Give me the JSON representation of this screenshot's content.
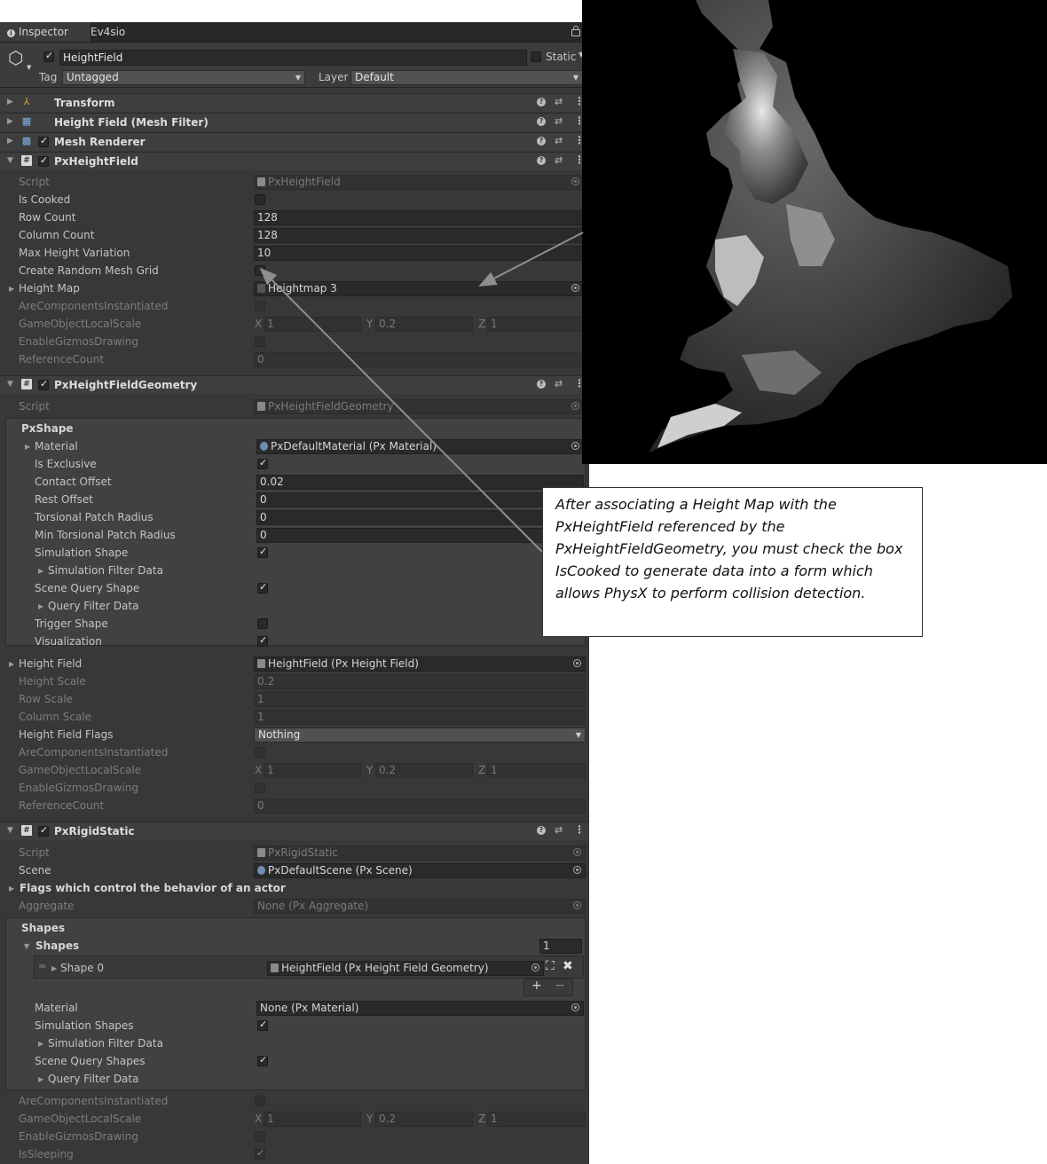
{
  "tabs": [
    {
      "label": "Inspector"
    },
    {
      "label": "Ev4sio"
    }
  ],
  "gameobject": {
    "name": "HeightField",
    "static_label": "Static",
    "tag_label": "Tag",
    "tag_value": "Untagged",
    "layer_label": "Layer",
    "layer_value": "Default"
  },
  "components": {
    "transform": {
      "title": "Transform"
    },
    "mesh_filter": {
      "title": "Height Field (Mesh Filter)"
    },
    "mesh_renderer": {
      "title": "Mesh Renderer"
    },
    "px_height_field": {
      "title": "PxHeightField",
      "labels": {
        "script": "Script",
        "is_cooked": "Is Cooked",
        "row_count": "Row Count",
        "column_count": "Column Count",
        "max_height_variation": "Max Height Variation",
        "create_random": "Create Random Mesh Grid",
        "height_map": "Height Map",
        "are_comp": "AreComponentsInstantiated",
        "local_scale": "GameObjectLocalScale",
        "gizmos": "EnableGizmosDrawing",
        "ref_count": "ReferenceCount"
      },
      "values": {
        "script": "PxHeightField",
        "row_count": "128",
        "column_count": "128",
        "max_height_variation": "10",
        "height_map": "Heightmap 3",
        "scale_x": "1",
        "scale_y": "0.2",
        "scale_z": "1",
        "ref_count": "0"
      }
    },
    "px_height_field_geometry": {
      "title": "PxHeightFieldGeometry",
      "labels": {
        "script": "Script",
        "pxshape": "PxShape",
        "material": "Material",
        "is_exclusive": "Is Exclusive",
        "contact_offset": "Contact Offset",
        "rest_offset": "Rest Offset",
        "torsional": "Torsional Patch Radius",
        "min_torsional": "Min Torsional Patch Radius",
        "sim_shape": "Simulation Shape",
        "sim_filter": "Simulation Filter Data",
        "scene_query": "Scene Query Shape",
        "query_filter": "Query Filter Data",
        "trigger": "Trigger Shape",
        "visualization": "Visualization",
        "height_field": "Height Field",
        "height_scale": "Height Scale",
        "row_scale": "Row Scale",
        "column_scale": "Column Scale",
        "hf_flags": "Height Field Flags",
        "are_comp": "AreComponentsInstantiated",
        "local_scale": "GameObjectLocalScale",
        "gizmos": "EnableGizmosDrawing",
        "ref_count": "ReferenceCount"
      },
      "values": {
        "script": "PxHeightFieldGeometry",
        "material": "PxDefaultMaterial (Px Material)",
        "contact_offset": "0.02",
        "rest_offset": "0",
        "torsional": "0",
        "min_torsional": "0",
        "height_field": "HeightField (Px Height Field)",
        "height_scale": "0.2",
        "row_scale": "1",
        "column_scale": "1",
        "hf_flags": "Nothing",
        "scale_x": "1",
        "scale_y": "0.2",
        "scale_z": "1",
        "ref_count": "0"
      }
    },
    "px_rigid_static": {
      "title": "PxRigidStatic",
      "labels": {
        "script": "Script",
        "scene": "Scene",
        "flags": "Flags which control the behavior of an actor",
        "aggregate": "Aggregate",
        "shapes_header": "Shapes",
        "shapes_list": "Shapes",
        "shape0": "Shape 0",
        "material": "Material",
        "sim_shapes": "Simulation Shapes",
        "sim_filter": "Simulation Filter Data",
        "scene_query": "Scene Query Shapes",
        "query_filter": "Query Filter Data",
        "are_comp": "AreComponentsInstantiated",
        "local_scale": "GameObjectLocalScale",
        "gizmos": "EnableGizmosDrawing",
        "sleeping": "IsSleeping"
      },
      "values": {
        "script": "PxRigidStatic",
        "scene": "PxDefaultScene (Px Scene)",
        "aggregate": "None (Px Aggregate)",
        "shapes_count": "1",
        "shape0": "HeightField (Px Height Field Geometry)",
        "material": "None (Px Material)",
        "scale_x": "1",
        "scale_y": "0.2",
        "scale_z": "1"
      }
    }
  },
  "axis": {
    "x": "X",
    "y": "Y",
    "z": "Z"
  },
  "list_buttons": {
    "add": "+",
    "remove": "−"
  },
  "annotation": {
    "text": "After associating a Height Map with the PxHeightField referenced by the PxHeightFieldGeometry, you must check the box IsCooked to generate data into a form which allows PhysX to perform collision detection."
  },
  "colors": {
    "panel": "#383838",
    "header": "#3e3e3e",
    "field": "#2a2a2a",
    "arrow": "#8e8e8e"
  }
}
